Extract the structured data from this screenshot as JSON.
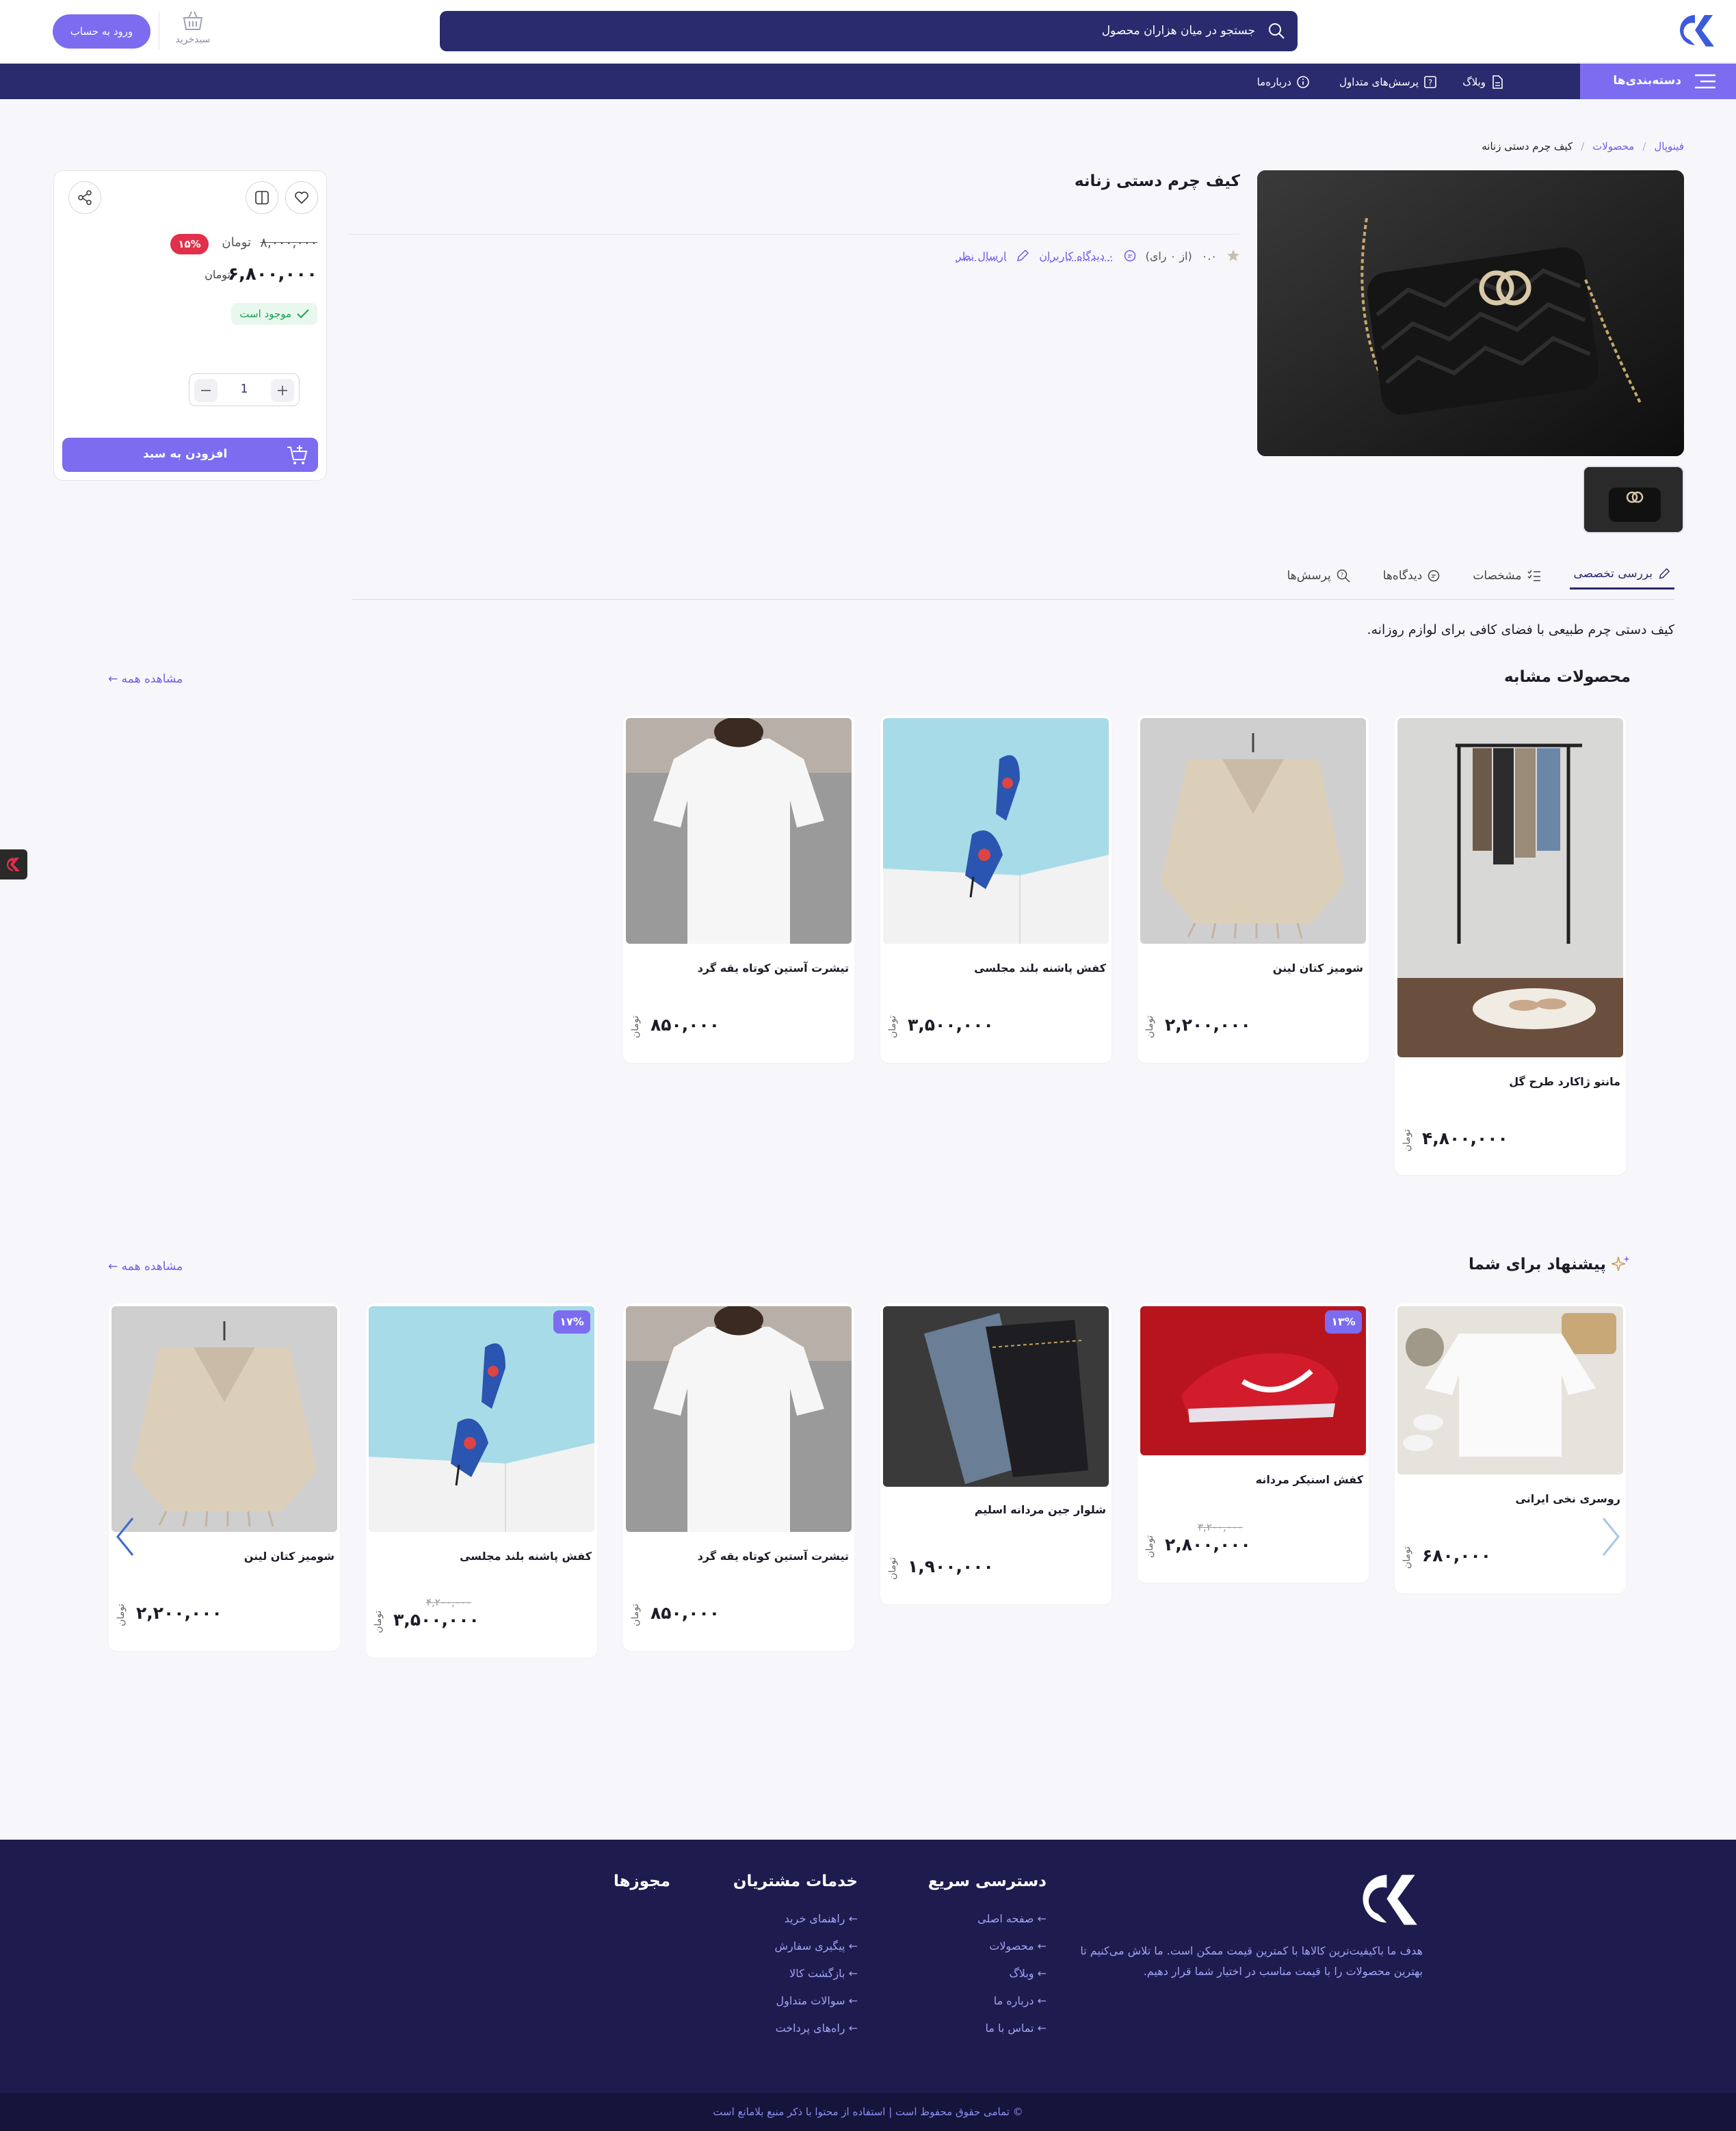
{
  "header": {
    "search_placeholder": "جستجو در میان هزاران محصول",
    "cart_label": "سبدخرید",
    "login_label": "ورود به حساب"
  },
  "nav": {
    "categories": "دسته‌بندی‌ها",
    "links": [
      "وبلاگ",
      "پرسش‌های متداول",
      "درباره‌ما"
    ]
  },
  "breadcrumb": [
    "فینوپال",
    "محصولات",
    "کیف چرم دستی زنانه"
  ],
  "product": {
    "title": "کیف چرم دستی زنانه",
    "rating": "۰.۰",
    "rating_count": "(از ۰ رای)",
    "reviews_link": "۰ دیدگاه کاربران",
    "write_review": "ارسال نظر",
    "old_price": "۸,۰۰۰,۰۰۰",
    "old_unit": "تومان",
    "discount": "۱۵%",
    "price": "۶,۸۰۰,۰۰۰",
    "unit": "تومان",
    "stock": "موجود است",
    "qty": "1",
    "add_to_cart": "افزودن به سبد",
    "description": "کیف دستی چرم طبیعی با فضای کافی برای لوازم روزانه."
  },
  "tabs": [
    "بررسی تخصصی",
    "مشخصات",
    "دیدگاه‌ها",
    "پرسش‌ها"
  ],
  "similar": {
    "title": "محصولات مشابه",
    "see_all": "مشاهده همه ←",
    "items": [
      {
        "name": "مانتو ژاکارد طرح گل",
        "price": "۴,۸۰۰,۰۰۰",
        "unit": "تومان"
      },
      {
        "name": "شومیز کتان لینن",
        "price": "۲,۲۰۰,۰۰۰",
        "unit": "تومان"
      },
      {
        "name": "کفش پاشنه بلند مجلسی",
        "price": "۳,۵۰۰,۰۰۰",
        "unit": "تومان"
      },
      {
        "name": "تیشرت آستین کوتاه یقه گرد",
        "price": "۸۵۰,۰۰۰",
        "unit": "تومان"
      }
    ]
  },
  "suggest": {
    "title": "پیشنهاد برای شما",
    "see_all": "مشاهده همه ←",
    "items": [
      {
        "name": "روسری نخی ایرانی",
        "price": "۶۸۰,۰۰۰",
        "unit": "تومان",
        "old": "",
        "badge": ""
      },
      {
        "name": "کفش اسنیکر مردانه",
        "price": "۲,۸۰۰,۰۰۰",
        "unit": "تومان",
        "old": "۳,۲۰۰,۰۰۰",
        "badge": "۱۳%"
      },
      {
        "name": "شلوار جین مردانه اسلیم",
        "price": "۱,۹۰۰,۰۰۰",
        "unit": "تومان",
        "old": "",
        "badge": ""
      },
      {
        "name": "تیشرت آستین کوتاه یقه گرد",
        "price": "۸۵۰,۰۰۰",
        "unit": "تومان",
        "old": "",
        "badge": ""
      },
      {
        "name": "کفش پاشنه بلند مجلسی",
        "price": "۳,۵۰۰,۰۰۰",
        "unit": "تومان",
        "old": "۴,۲۰۰,۰۰۰",
        "badge": "۱۷%"
      },
      {
        "name": "شومیز کتان لینن",
        "price": "۲,۲۰۰,۰۰۰",
        "unit": "تومان",
        "old": "",
        "badge": ""
      }
    ]
  },
  "footer": {
    "about": "هدف ما باکیفیت‌ترین کالاها با کمترین قیمت ممکن است. ما تلاش می‌کنیم تا بهترین محصولات را با قیمت مناسب در اختیار شما قرار دهیم.",
    "quick_title": "دسترسی سریع",
    "quick": [
      "← صفحه اصلی",
      "← محصولات",
      "← وبلاگ",
      "← درباره ما",
      "← تماس با ما"
    ],
    "service_title": "خدمات مشتریان",
    "service": [
      "← راهنمای خرید",
      "← پیگیری سفارش",
      "← بازگشت کالا",
      "← سوالات متداول",
      "← راه‌های پرداخت"
    ],
    "license_title": "مجوزها",
    "copyright": "© تمامی حقوق محفوظ است | استفاده از محتوا با ذکر منبع بلامانع است"
  },
  "colors": {
    "primary": "#7b6cf0",
    "dark": "#2a2a6e",
    "footer": "#1e1c4e",
    "danger": "#e0304a"
  }
}
